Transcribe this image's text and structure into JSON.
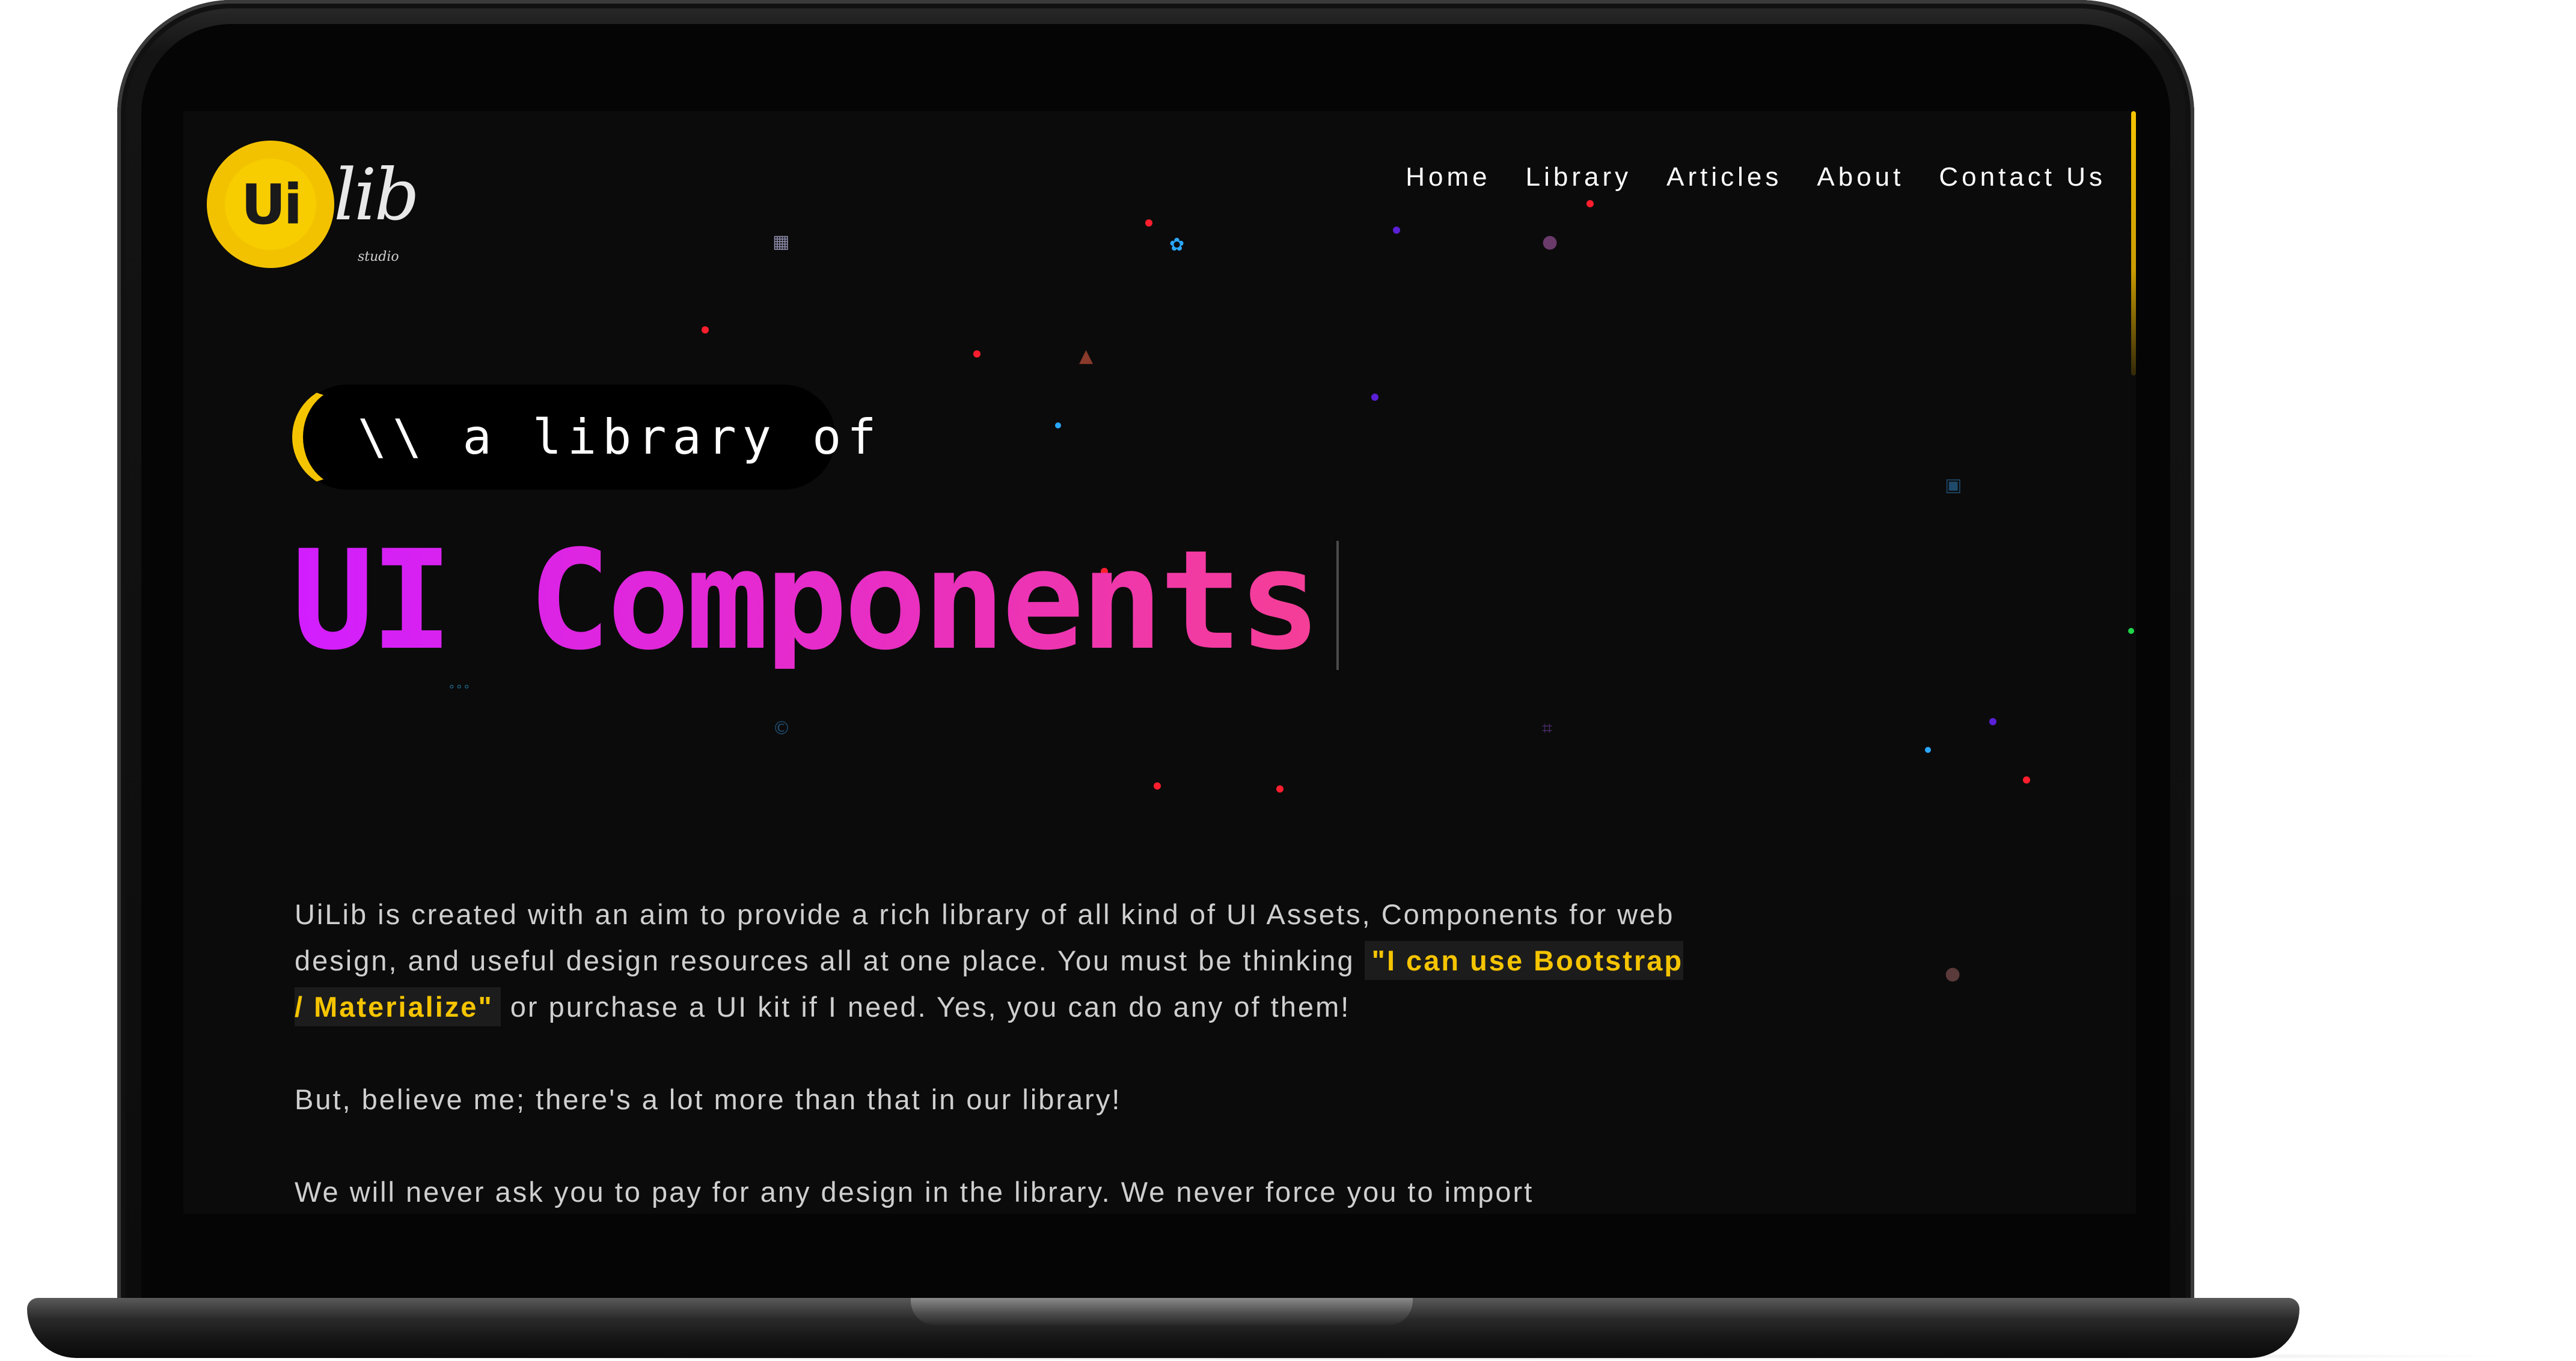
{
  "logo": {
    "badge_text": "Ui",
    "script_text": "lib",
    "sub_text": "studio"
  },
  "nav": {
    "items": [
      {
        "label": "Home"
      },
      {
        "label": "Library"
      },
      {
        "label": "Articles"
      },
      {
        "label": "About"
      },
      {
        "label": "Contact Us"
      }
    ]
  },
  "hero": {
    "tagline": "\\\\ a library of",
    "title": "UI Components"
  },
  "intro": {
    "p1_before": "UiLib is created with an aim to provide a rich library of all kind of UI Assets, Components for web design, and useful design resources all at one place. You must be thinking ",
    "p1_highlight": "\"I can use Bootstrap / Materialize\"",
    "p1_after": " or purchase a UI kit if I need. Yes, you can do any of them!",
    "p2": "But, believe me; there's a lot more than that in our library!",
    "p3": "We will never ask you to pay for any design in the library. We never force you to import"
  },
  "colors": {
    "accent_yellow": "#f5c400",
    "title_gradient_start": "#d21eff",
    "title_gradient_end": "#f53e96",
    "background": "#0b0b0b"
  }
}
